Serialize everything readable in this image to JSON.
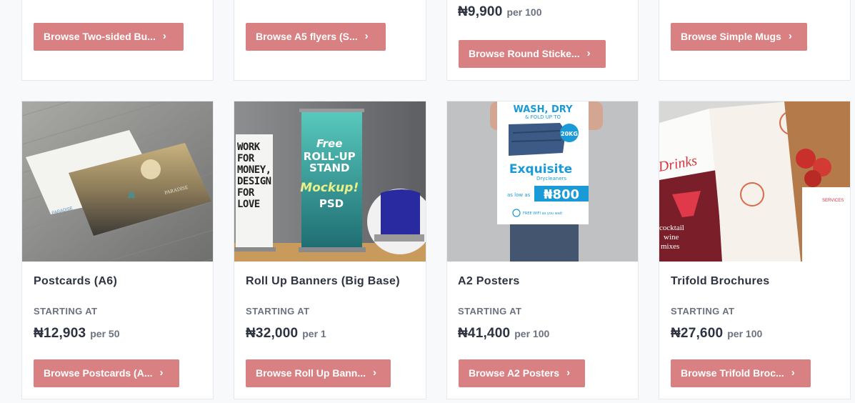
{
  "top_row": [
    {
      "button": "Browse Two-sided Bu..."
    },
    {
      "button": "Browse A5 flyers (S..."
    },
    {
      "price": "₦9,900",
      "per": "per 100",
      "button": "Browse Round Sticke..."
    },
    {
      "button": "Browse Simple Mugs"
    }
  ],
  "products": [
    {
      "title": "Postcards (A6)",
      "starting": "STARTING AT",
      "price": "₦12,903",
      "per": "per 50",
      "button": "Browse Postcards (A...",
      "image_text": {
        "brand": "PARADISE"
      }
    },
    {
      "title": "Roll Up Banners (Big Base)",
      "starting": "STARTING AT",
      "price": "₦32,000",
      "per": "per 1",
      "button": "Browse Roll Up Bann...",
      "image_text": {
        "l1": "WORK",
        "l2": "FOR",
        "l3": "MONEY,",
        "l4": "DESIGN",
        "l5": "FOR",
        "l6": "LOVE",
        "b1": "Free",
        "b2": "ROLL-UP",
        "b3": "STAND",
        "b4": "Mockup!",
        "b5": "PSD"
      }
    },
    {
      "title": "A2 Posters",
      "starting": "STARTING AT",
      "price": "₦41,400",
      "per": "per 100",
      "button": "Browse A2 Posters",
      "image_text": {
        "h1": "WASH, DRY",
        "h2": "& FOLD UP TO",
        "kg": "20KG",
        "brand": "Exquisite",
        "sub": "Drycleaners",
        "as_low": "as low as",
        "amount": "₦800",
        "wifi": "FREE WIFI as you wait"
      }
    },
    {
      "title": "Trifold Brochures",
      "starting": "STARTING AT",
      "price": "₦27,600",
      "per": "per 100",
      "button": "Browse Trifold Broc...",
      "image_text": {
        "drinks": "Drinks",
        "cocktail": "cocktail",
        "wine": "wine",
        "mixes": "mixes",
        "services": "SERVICES"
      }
    }
  ],
  "colors": {
    "button": "#d98083",
    "text": "#2d3340",
    "muted": "#6b7280",
    "border": "#e6e8ec"
  },
  "icons": {
    "button_chevron": "chevron-right-icon"
  }
}
